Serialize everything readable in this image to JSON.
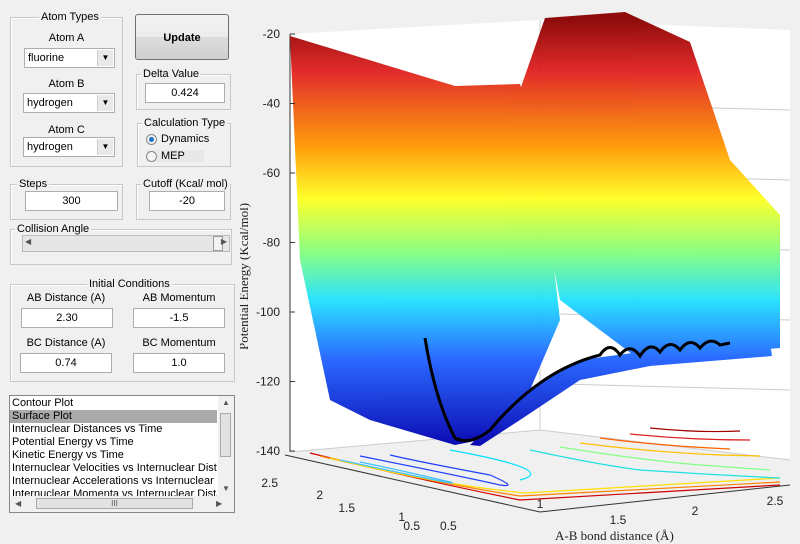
{
  "atom_types": {
    "title": "Atom Types",
    "atom_a": {
      "label": "Atom A",
      "value": "fluorine"
    },
    "atom_b": {
      "label": "Atom B",
      "value": "hydrogen"
    },
    "atom_c": {
      "label": "Atom C",
      "value": "hydrogen"
    }
  },
  "update_label": "Update",
  "delta": {
    "title": "Delta Value",
    "value": "0.424"
  },
  "calc_type": {
    "title": "Calculation Type",
    "options": [
      "Dynamics",
      "MEP"
    ],
    "selected": "Dynamics"
  },
  "steps": {
    "title": "Steps",
    "value": "300"
  },
  "cutoff": {
    "title": "Cutoff (Kcal/ mol)",
    "value": "-20"
  },
  "collision_angle": {
    "title": "Collision Angle",
    "position": 0.97
  },
  "initial": {
    "title": "Initial Conditions",
    "ab_distance": {
      "label": "AB Distance (A)",
      "value": "2.30"
    },
    "ab_momentum": {
      "label": "AB Momentum",
      "value": "-1.5"
    },
    "bc_distance": {
      "label": "BC Distance (A)",
      "value": "0.74"
    },
    "bc_momentum": {
      "label": "BC Momentum",
      "value": "1.0"
    }
  },
  "plot_list": {
    "items": [
      "Contour Plot",
      "Surface Plot",
      "Internuclear Distances vs Time",
      "Potential Energy vs Time",
      "Kinetic Energy vs Time",
      "Internuclear Velocities vs Internuclear Distance",
      "Internuclear Accelerations vs Internuclear Distance",
      "Internuclear Momenta vs Internuclear Distance"
    ],
    "selected": "Surface Plot",
    "hscroll_grip": "III"
  },
  "chart": {
    "zlabel": "Potential Energy (Kcal/mol)",
    "xlabel": "A-B bond distance (Å)",
    "z_ticks": [
      "-20",
      "-40",
      "-60",
      "-80",
      "-100",
      "-120",
      "-140"
    ],
    "x_ticks": [
      "0.5",
      "1",
      "1.5",
      "2",
      "2.5"
    ],
    "y_ticks": [
      "2.5",
      "2",
      "1.5",
      "1",
      "0.5"
    ],
    "colormap": "jet"
  }
}
